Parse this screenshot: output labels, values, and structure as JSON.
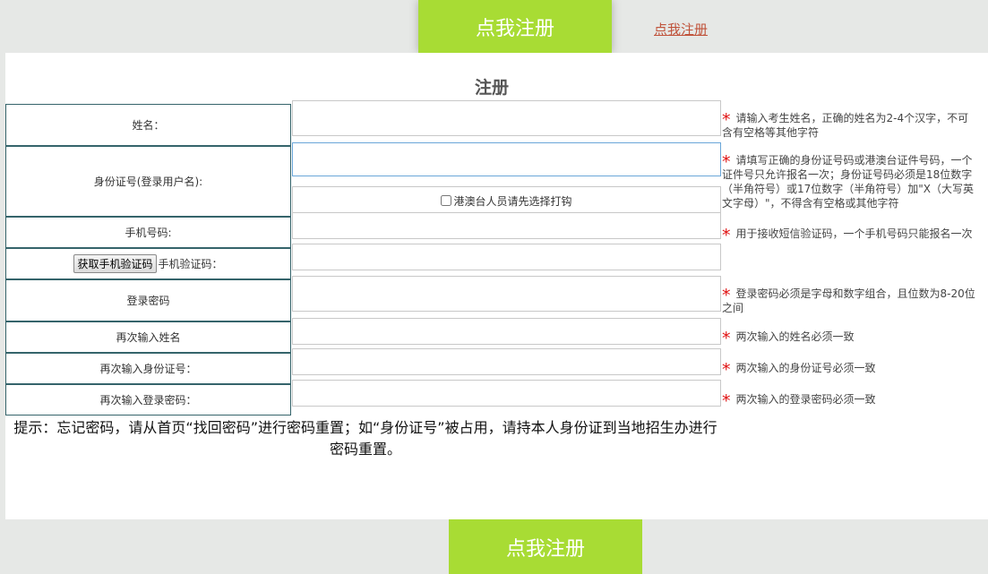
{
  "header": {
    "register_button": "点我注册",
    "register_link": "点我注册"
  },
  "form": {
    "title": "注册",
    "fields": [
      {
        "label": "姓名：",
        "value": "",
        "hint": "请输入考生姓名，正确的姓名为2-4个汉字，不可含有空格等其他字符"
      },
      {
        "label": "身份证号(登录用户名):",
        "value": "",
        "hint": "请填写正确的身份证号码或港澳台证件号码，一个证件号只允许报名一次；身份证号码必须是18位数字（半角符号）或17位数字（半角符号）加\"X（大写英文字母）\"，不得含有空格或其他字符"
      },
      {
        "label": "手机号码:",
        "value": "",
        "hint": "用于接收短信验证码，一个手机号码只能报名一次"
      },
      {
        "label": "手机验证码：",
        "value": "",
        "hint": ""
      },
      {
        "label": "登录密码",
        "value": "",
        "hint": "登录密码必须是字母和数字组合，且位数为8-20位之间"
      },
      {
        "label": "再次输入姓名",
        "value": "",
        "hint": "两次输入的姓名必须一致"
      },
      {
        "label": "再次输入身份证号：",
        "value": "",
        "hint": "两次输入的身份证号必须一致"
      },
      {
        "label": "再次输入登录密码：",
        "value": "",
        "hint": "两次输入的登录密码必须一致"
      }
    ],
    "hk_checkbox_label": "港澳台人员请先选择打钩",
    "hk_checkbox_checked": false,
    "sms_button": "获取手机验证码",
    "required_mark": "*"
  },
  "tip": "提示：忘记密码，请从首页“找回密码”进行密码重置；如“身份证号”被占用，请持本人身份证到当地招生办进行密码重置。",
  "footer": {
    "register_button": "点我注册"
  },
  "colors": {
    "accent_green": "#a8dc34",
    "link": "#c0533b",
    "required": "#e01010",
    "label_border": "#35646b"
  }
}
